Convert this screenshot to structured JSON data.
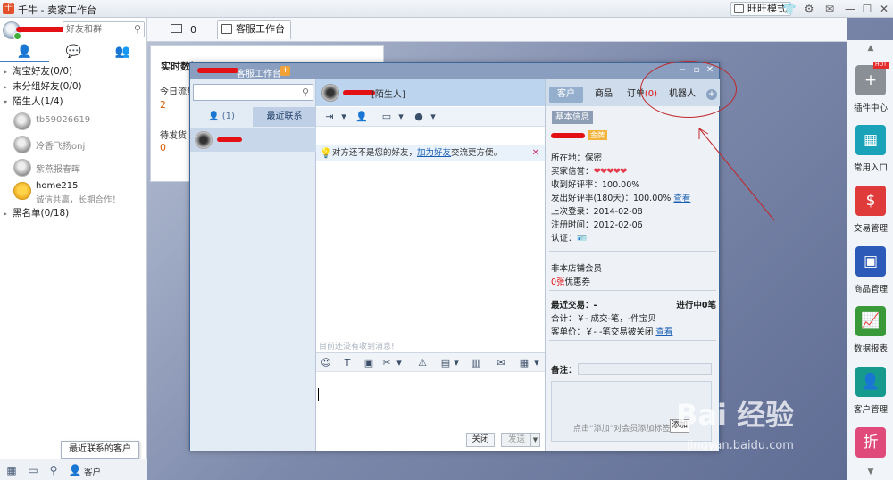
{
  "app": {
    "title": "千牛 - 卖家工作台",
    "mode_button": "旺旺模式"
  },
  "left": {
    "search_placeholder": "好友和群",
    "groups": [
      {
        "label": "淘宝好友(0/0)",
        "expanded": false
      },
      {
        "label": "未分组好友(0/0)",
        "expanded": false
      },
      {
        "label": "陌生人(1/4)",
        "expanded": true
      }
    ],
    "contacts": [
      {
        "name": "tb59026619"
      },
      {
        "name": "冷香飞扬onj"
      },
      {
        "name": "紫燕报春晖"
      },
      {
        "name": "home215",
        "signature": "诚信共赢，长期合作！"
      }
    ],
    "blacklist": "黑名单(0/18)",
    "tooltip": "最近联系的客户",
    "bottom_label": "客户"
  },
  "header": {
    "mail_count": "0",
    "workspace_tab": "客服工作台"
  },
  "realtime": {
    "title": "实时数据",
    "flow_label": "今日流量",
    "flow_value": "2",
    "pending_label": "待发货",
    "pending_value": "0"
  },
  "chat": {
    "window_title": "客服工作台",
    "contact_count": "(1)",
    "recent_tab": "最近联系",
    "stranger_tag": "[陌生人]",
    "notice": {
      "prefix": "对方还不是您的好友，",
      "link": "加为好友",
      "suffix": "交流更方便。"
    },
    "empty_msg": "目前还没有收到消息!",
    "close_btn": "关闭",
    "send_btn": "发送"
  },
  "customer_panel": {
    "tabs": [
      "客户",
      "商品",
      "订单",
      "机器人"
    ],
    "order_count": "(0)",
    "basic_info_btn": "基本信息",
    "level_badge": "金牌",
    "location": "所在地：保密",
    "buyer_credit_label": "买家信誉：",
    "good_rate": "收到好评率：100.00%",
    "sent_good_rate": "发出好评率(180天)：100.00%",
    "view_link": "查看",
    "last_login": "上次登录：2014-02-08",
    "register": "注册时间：2012-02-06",
    "cert_label": "认证：",
    "not_member": "非本店铺会员",
    "coupon_count": "0张",
    "coupon_label": "优惠券",
    "recent_trade_label": "最近交易：-",
    "in_progress": "进行中0笔",
    "total": "合计：￥-   成交-笔，-件宝贝",
    "avg_price": "客单价：￥-   -笔交易被关闭",
    "view_link2": "查看",
    "note_label": "备注：",
    "tag_hint": "点击“添加”对会员添加标签",
    "add_btn": "添加"
  },
  "right_apps": [
    {
      "label": "插件中心",
      "icon": "plus-icon",
      "color": "#8a8f96",
      "hot": "HOT"
    },
    {
      "label": "常用入口",
      "icon": "grid-icon",
      "color": "#1aa3b8"
    },
    {
      "label": "交易管理",
      "icon": "dollar-icon",
      "color": "#df3b3b"
    },
    {
      "label": "商品管理",
      "icon": "box-icon",
      "color": "#2c5ab8"
    },
    {
      "label": "数据报表",
      "icon": "chart-icon",
      "color": "#3a9a3a"
    },
    {
      "label": "客户管理",
      "icon": "user-icon",
      "color": "#179a8e"
    },
    {
      "label": "折",
      "icon": "discount-icon",
      "color": "#e04a7a"
    }
  ],
  "watermark": {
    "brand": "Bai 经验",
    "url": "jingyan.baidu.com"
  }
}
